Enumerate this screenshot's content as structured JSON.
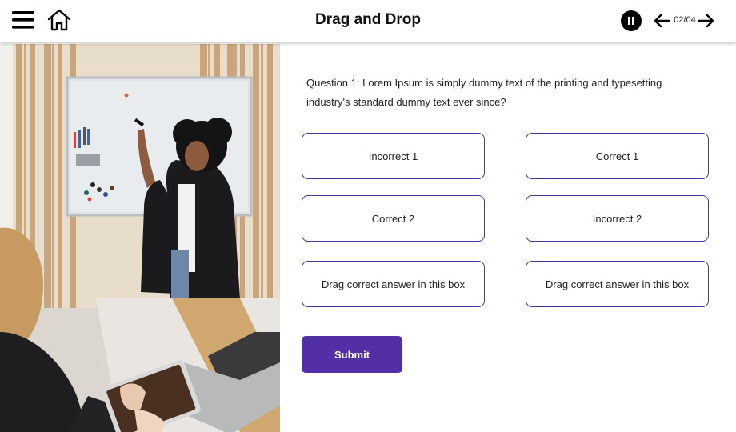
{
  "header": {
    "title": "Drag and Drop",
    "page_counter": "02/04",
    "icons": [
      "menu-icon",
      "home-icon",
      "pause-icon",
      "arrow-left-icon",
      "arrow-right-icon"
    ]
  },
  "image": {
    "description_icon": "presentation-photo"
  },
  "question": {
    "text": "Question 1:  Lorem Ipsum is simply dummy text of the printing and typesetting industry's standard dummy text ever since?"
  },
  "options": [
    {
      "label": "Incorrect 1"
    },
    {
      "label": "Correct 1"
    },
    {
      "label": "Correct 2"
    },
    {
      "label": "Incorrect 2"
    }
  ],
  "drop_zones": [
    {
      "label": "Drag correct answer in this box"
    },
    {
      "label": "Drag correct answer in this box"
    }
  ],
  "submit_label": "Submit",
  "colors": {
    "accent": "#532fa5",
    "border": "#4b2fa1",
    "header_bg": "#ffffff"
  }
}
